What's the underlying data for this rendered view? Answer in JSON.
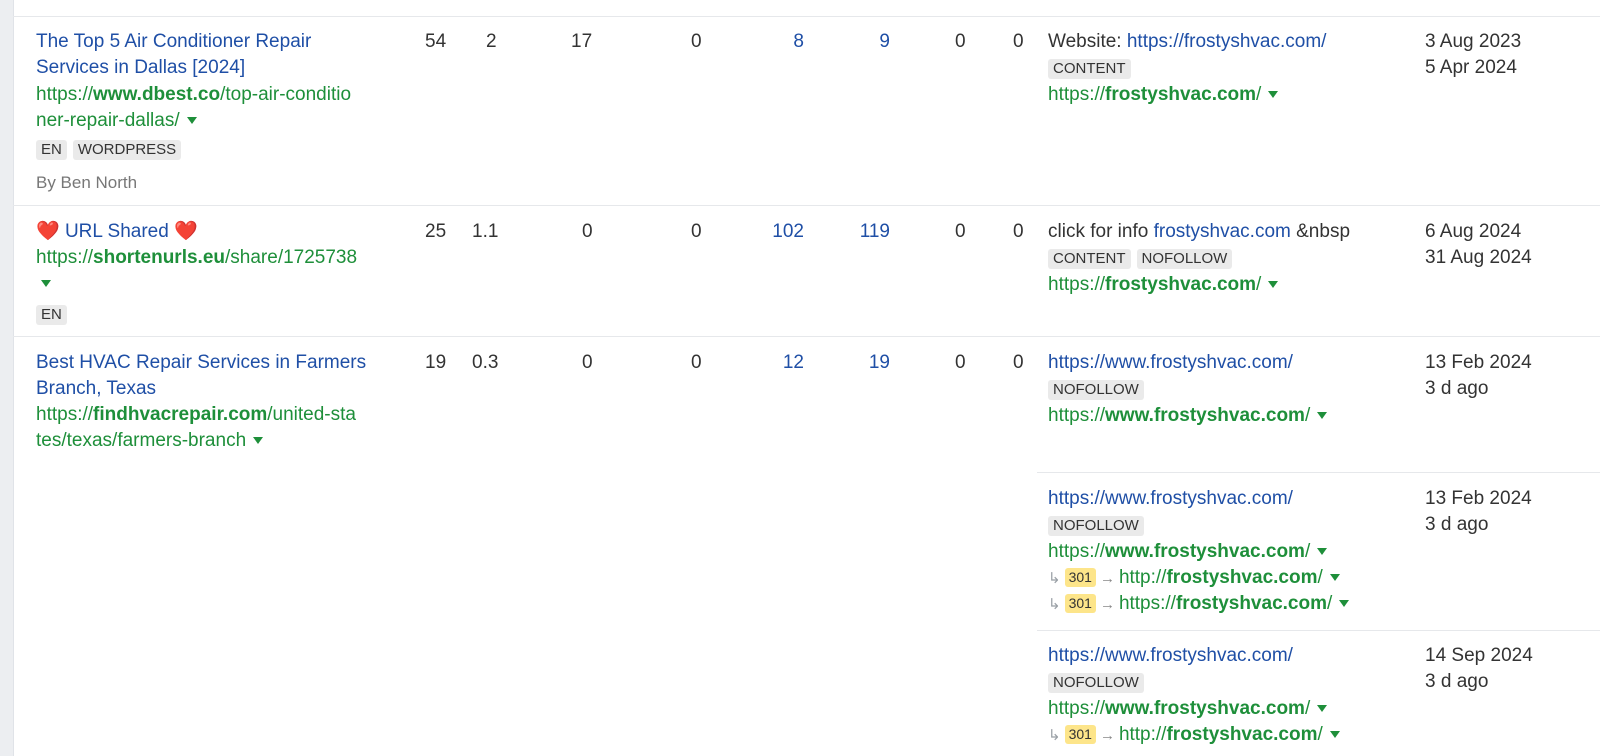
{
  "rows": [
    {
      "title_lines": [
        "The Top 5 Air Conditioner Repair",
        "Services in Dallas [2024]"
      ],
      "url": {
        "prefix": "https://",
        "domain": "www.dbest.co",
        "path_lines": [
          "/top-air-conditio",
          "ner-repair-dallas/"
        ]
      },
      "badges": [
        "EN",
        "WORDPRESS"
      ],
      "author": "By Ben North",
      "metrics": [
        "54",
        "2",
        "17",
        "0",
        "8",
        "9",
        "0",
        "0"
      ],
      "links": [
        {
          "anchor_prefix": "Website: ",
          "anchor_link": "https://frostyshvac.com/",
          "badges": [
            "CONTENT"
          ],
          "target": {
            "prefix": "https://",
            "domain": "frostyshvac.com",
            "path": "/"
          },
          "redirects": [],
          "dates": [
            "3 Aug 2023",
            "5 Apr 2024"
          ]
        }
      ]
    },
    {
      "title_prefix": "❤️",
      "title_main": " URL Shared ",
      "title_suffix": "❤️",
      "url": {
        "prefix": "https://",
        "domain": "shortenurls.eu",
        "path_lines": [
          "/share/1725738"
        ]
      },
      "badges": [
        "EN"
      ],
      "metrics": [
        "25",
        "1.1",
        "0",
        "0",
        "102",
        "119",
        "0",
        "0"
      ],
      "links": [
        {
          "anchor_prefix": "click for info ",
          "anchor_link": "frostyshvac.com",
          "anchor_suffix": " &nbsp",
          "badges": [
            "CONTENT",
            "NOFOLLOW"
          ],
          "target": {
            "prefix": "https://",
            "domain": "frostyshvac.com",
            "path": "/"
          },
          "redirects": [],
          "dates": [
            "6 Aug 2024",
            "31 Aug 2024"
          ]
        }
      ]
    },
    {
      "title_lines": [
        "Best HVAC Repair Services in Farmers",
        "Branch, Texas"
      ],
      "url": {
        "prefix": "https://",
        "domain": "findhvacrepair.com",
        "path_lines": [
          "/united-sta",
          "tes/texas/farmers-branch"
        ]
      },
      "metrics": [
        "19",
        "0.3",
        "0",
        "0",
        "12",
        "19",
        "0",
        "0"
      ],
      "links": [
        {
          "anchor_link": "https://www.frostyshvac.com/",
          "badges": [
            "NOFOLLOW"
          ],
          "target": {
            "prefix": "https://",
            "domain": "www.frostyshvac.com",
            "path": "/"
          },
          "redirects": [],
          "dates": [
            "13 Feb 2024",
            "3 d ago"
          ]
        },
        {
          "anchor_link": "https://www.frostyshvac.com/",
          "badges": [
            "NOFOLLOW"
          ],
          "target": {
            "prefix": "https://",
            "domain": "www.frostyshvac.com",
            "path": "/"
          },
          "redirects": [
            {
              "code": "301",
              "prefix": "http://",
              "domain": "frostyshvac.com",
              "path": "/"
            },
            {
              "code": "301",
              "prefix": "https://",
              "domain": "frostyshvac.com",
              "path": "/"
            }
          ],
          "dates": [
            "13 Feb 2024",
            "3 d ago"
          ]
        },
        {
          "anchor_link": "https://www.frostyshvac.com/",
          "badges": [
            "NOFOLLOW"
          ],
          "target": {
            "prefix": "https://",
            "domain": "www.frostyshvac.com",
            "path": "/"
          },
          "redirects": [
            {
              "code": "301",
              "prefix": "http://",
              "domain": "frostyshvac.com",
              "path": "/"
            }
          ],
          "dates": [
            "14 Sep 2024",
            "3 d ago"
          ]
        }
      ]
    }
  ],
  "symbols": {
    "hook": "↳",
    "arrow": "→"
  }
}
